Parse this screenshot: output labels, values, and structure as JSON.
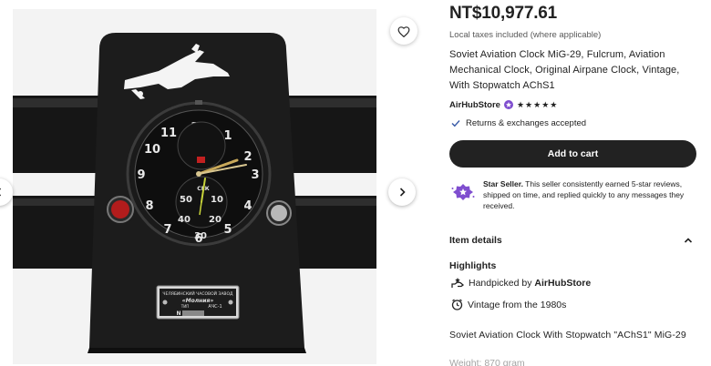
{
  "listing": {
    "price": "NT$10,977.61",
    "tax_note": "Local taxes included (where applicable)",
    "title": "Soviet Aviation Clock MiG-29, Fulcrum, Aviation Mechanical Clock, Original Airpane Clock, Vintage, With Stopwatch AChS1",
    "seller": "AirHubStore",
    "rating_stars": 5,
    "returns": "Returns & exchanges accepted",
    "add_to_cart": "Add to cart",
    "star_seller": {
      "label": "Star Seller.",
      "text": " This seller consistently earned 5-star reviews, shipped on time, and replied quickly to any messages they received."
    },
    "item_details": "Item details",
    "highlights_title": "Highlights",
    "handpicked_prefix": "Handpicked by ",
    "handpicked_by": "AirHubStore",
    "vintage": "Vintage from the 1980s",
    "description": "Soviet Aviation Clock With Stopwatch \"AChS1\" MiG-29",
    "weight_partial": "Weight: 870 gram"
  },
  "image": {
    "plate_line1": "ЧЕЛЯБИНСКИЙ ЧАСОВОЙ ЗАВОД",
    "plate_line2": "«Молния»",
    "plate_type": "ТИП",
    "plate_model": "АЧС-1",
    "plate_serial_prefix": "N",
    "dial_numbers": [
      "12",
      "1",
      "2",
      "3",
      "4",
      "5",
      "6",
      "7",
      "8",
      "9",
      "10",
      "11"
    ],
    "sub_numbers": [
      "50",
      "10",
      "20",
      "30",
      "40"
    ],
    "sub_label": "СЕК"
  },
  "colors": {
    "text": "#222222",
    "muted": "#595959",
    "button": "#222222",
    "star_seller_purple": "#7f4ecf",
    "photo_bg": "#f2f2f2"
  },
  "icons": [
    "heart-icon",
    "chevron-left-icon",
    "chevron-right-icon",
    "verified-badge-icon",
    "star-icon",
    "checkmark-icon",
    "star-seller-icon",
    "chevron-up-icon",
    "handpicked-icon",
    "clock-icon"
  ]
}
